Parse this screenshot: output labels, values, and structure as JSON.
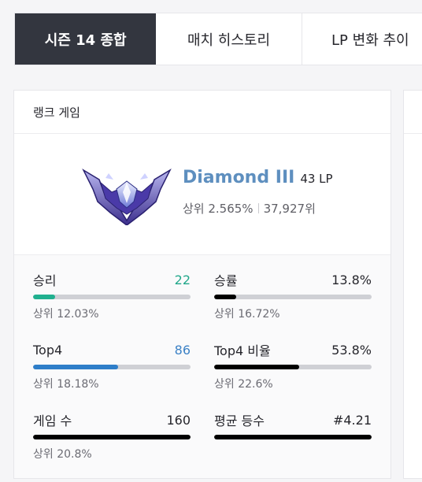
{
  "tabs": [
    {
      "label": "시즌 14 종합",
      "active": true
    },
    {
      "label": "매치 히스토리",
      "active": false
    },
    {
      "label": "LP 변화 추이",
      "active": false
    }
  ],
  "card": {
    "title": "랭크 게임",
    "tier": "Diamond III",
    "lp": "43 LP",
    "top_percent": "상위 2.565%",
    "rank_number": "37,927위",
    "emblem_icon": "diamond-rank-emblem"
  },
  "stats": {
    "wins": {
      "label": "승리",
      "value": "22",
      "sub": "상위 12.03%",
      "fill": 0.14,
      "color": "#20b08f"
    },
    "winrate": {
      "label": "승률",
      "value": "13.8%",
      "sub": "상위 16.72%",
      "fill": 0.138,
      "color": "#000000"
    },
    "top4": {
      "label": "Top4",
      "value": "86",
      "sub": "상위 18.18%",
      "fill": 0.54,
      "color": "#2e7ec9"
    },
    "top4rate": {
      "label": "Top4 비율",
      "value": "53.8%",
      "sub": "상위 22.6%",
      "fill": 0.538,
      "color": "#000000"
    },
    "games": {
      "label": "게임 수",
      "value": "160",
      "sub": "상위 20.8%",
      "fill": 1.0,
      "color": "#000000"
    },
    "avgplace": {
      "label": "평균 등수",
      "value": "#4.21",
      "sub": "",
      "fill": 1.0,
      "color": "#000000"
    }
  }
}
